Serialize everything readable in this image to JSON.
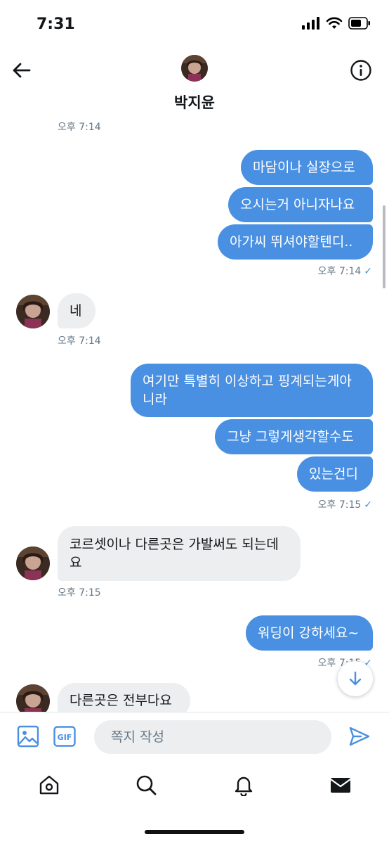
{
  "status_bar": {
    "time": "7:31"
  },
  "header": {
    "name": "박지윤"
  },
  "messages": [
    {
      "type": "timestamp",
      "text": "오후 7:14"
    },
    {
      "type": "out",
      "text": "마담이나 실장으로"
    },
    {
      "type": "out",
      "text": "오시는거 아니자나요"
    },
    {
      "type": "out",
      "text": "아가씨 뛰셔야할텐디.."
    },
    {
      "type": "timestamp",
      "text": "오후 7:14",
      "read": true
    },
    {
      "type": "in",
      "text": "네"
    },
    {
      "type": "timestamp",
      "text": "오후 7:14"
    },
    {
      "type": "out",
      "text": "여기만 특별히 이상하고 핑계되는게아니라"
    },
    {
      "type": "out",
      "text": "그냥 그렇게생각할수도"
    },
    {
      "type": "out",
      "text": "있는건디"
    },
    {
      "type": "timestamp",
      "text": "오후 7:15",
      "read": true
    },
    {
      "type": "in",
      "text": "코르셋이나 다른곳은 가발써도 되는데요"
    },
    {
      "type": "timestamp",
      "text": "오후 7:15"
    },
    {
      "type": "out",
      "text": "워딩이 강하세요~"
    },
    {
      "type": "timestamp",
      "text": "오후 7:15",
      "read": true
    },
    {
      "type": "in",
      "text": "다른곳은 전부다요"
    }
  ],
  "compose": {
    "placeholder": "쪽지 작성"
  },
  "icons": {
    "back": "arrow-left-icon",
    "info": "info-icon",
    "image": "image-icon",
    "gif": "gif-icon",
    "send": "send-icon",
    "home": "home-icon",
    "search": "search-icon",
    "notifications": "bell-icon",
    "messages": "envelope-icon",
    "scroll_down": "arrow-down-icon"
  },
  "colors": {
    "accent": "#4a90e2",
    "incoming_bubble": "#eceef0",
    "meta_text": "#657786"
  }
}
